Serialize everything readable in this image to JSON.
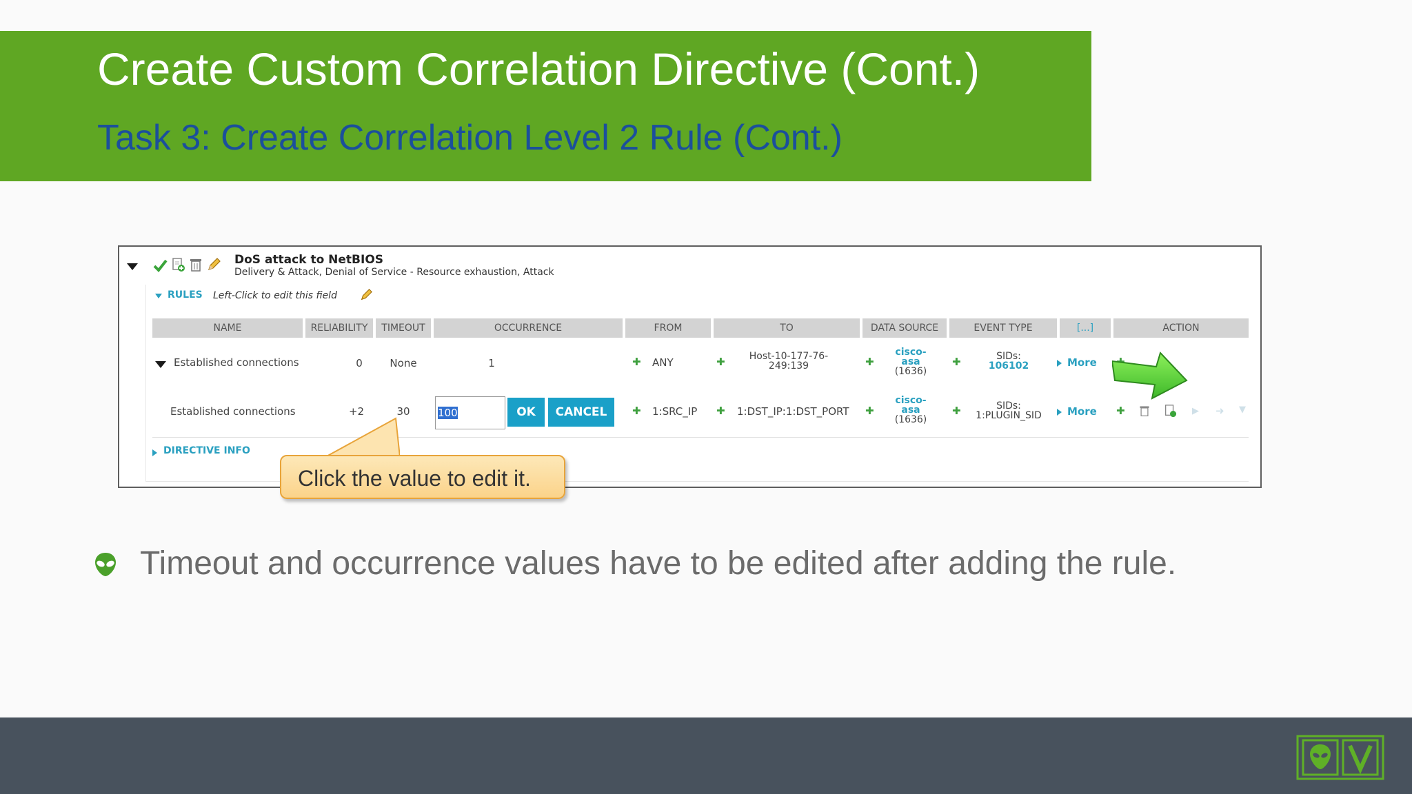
{
  "slide": {
    "title": "Create Custom Correlation Directive (Cont.)",
    "subtitle": "Task 3: Create Correlation Level 2 Rule (Cont.)",
    "bullet": "Timeout and occurrence values have to be edited after adding the rule.",
    "callout": "Click the value to edit it."
  },
  "directive": {
    "name": "DoS attack to NetBIOS",
    "taxonomy": "Delivery & Attack, Denial of Service - Resource exhaustion, Attack",
    "rules_label": "RULES",
    "rules_hint": "Left-Click to edit this field",
    "directive_info_label": "DIRECTIVE INFO"
  },
  "table": {
    "headers": {
      "name": "NAME",
      "reliability": "RELIABILITY",
      "timeout": "TIMEOUT",
      "occurrence": "OCCURRENCE",
      "from": "FROM",
      "to": "TO",
      "data_source": "DATA SOURCE",
      "event_type": "EVENT TYPE",
      "expand": "[...]",
      "action": "ACTION"
    },
    "rows": [
      {
        "name": "Established connections",
        "reliability": "0",
        "timeout": "None",
        "occurrence": "1",
        "from": "ANY",
        "to_line1": "Host-10-177-76-",
        "to_line2": "249:139",
        "ds_line1": "cisco-",
        "ds_line2": "asa",
        "ds_line3": "(1636)",
        "sids_label": "SIDs:",
        "sids_value": "106102",
        "more": "More"
      },
      {
        "name": "Established connections",
        "reliability": "+2",
        "timeout": "30",
        "occurrence_edit": "100",
        "ok_label": "OK",
        "cancel_label": "CANCEL",
        "from": "1:SRC_IP",
        "to": "1:DST_IP:1:DST_PORT",
        "ds_line1": "cisco-",
        "ds_line2": "asa",
        "ds_line3": "(1636)",
        "sids_label": "SIDs:",
        "sids_value": "1:PLUGIN_SID",
        "more": "More"
      }
    ]
  },
  "colors": {
    "banner": "#5fa723",
    "subtitle": "#1b4f9c",
    "accent": "#1aa0c8",
    "footer": "#48525d"
  },
  "icons": [
    "collapse-triangle-icon",
    "check-icon",
    "copy-icon",
    "trash-icon",
    "pencil-icon",
    "green-arrow-icon",
    "alien-bullet-icon",
    "logo-icon"
  ]
}
